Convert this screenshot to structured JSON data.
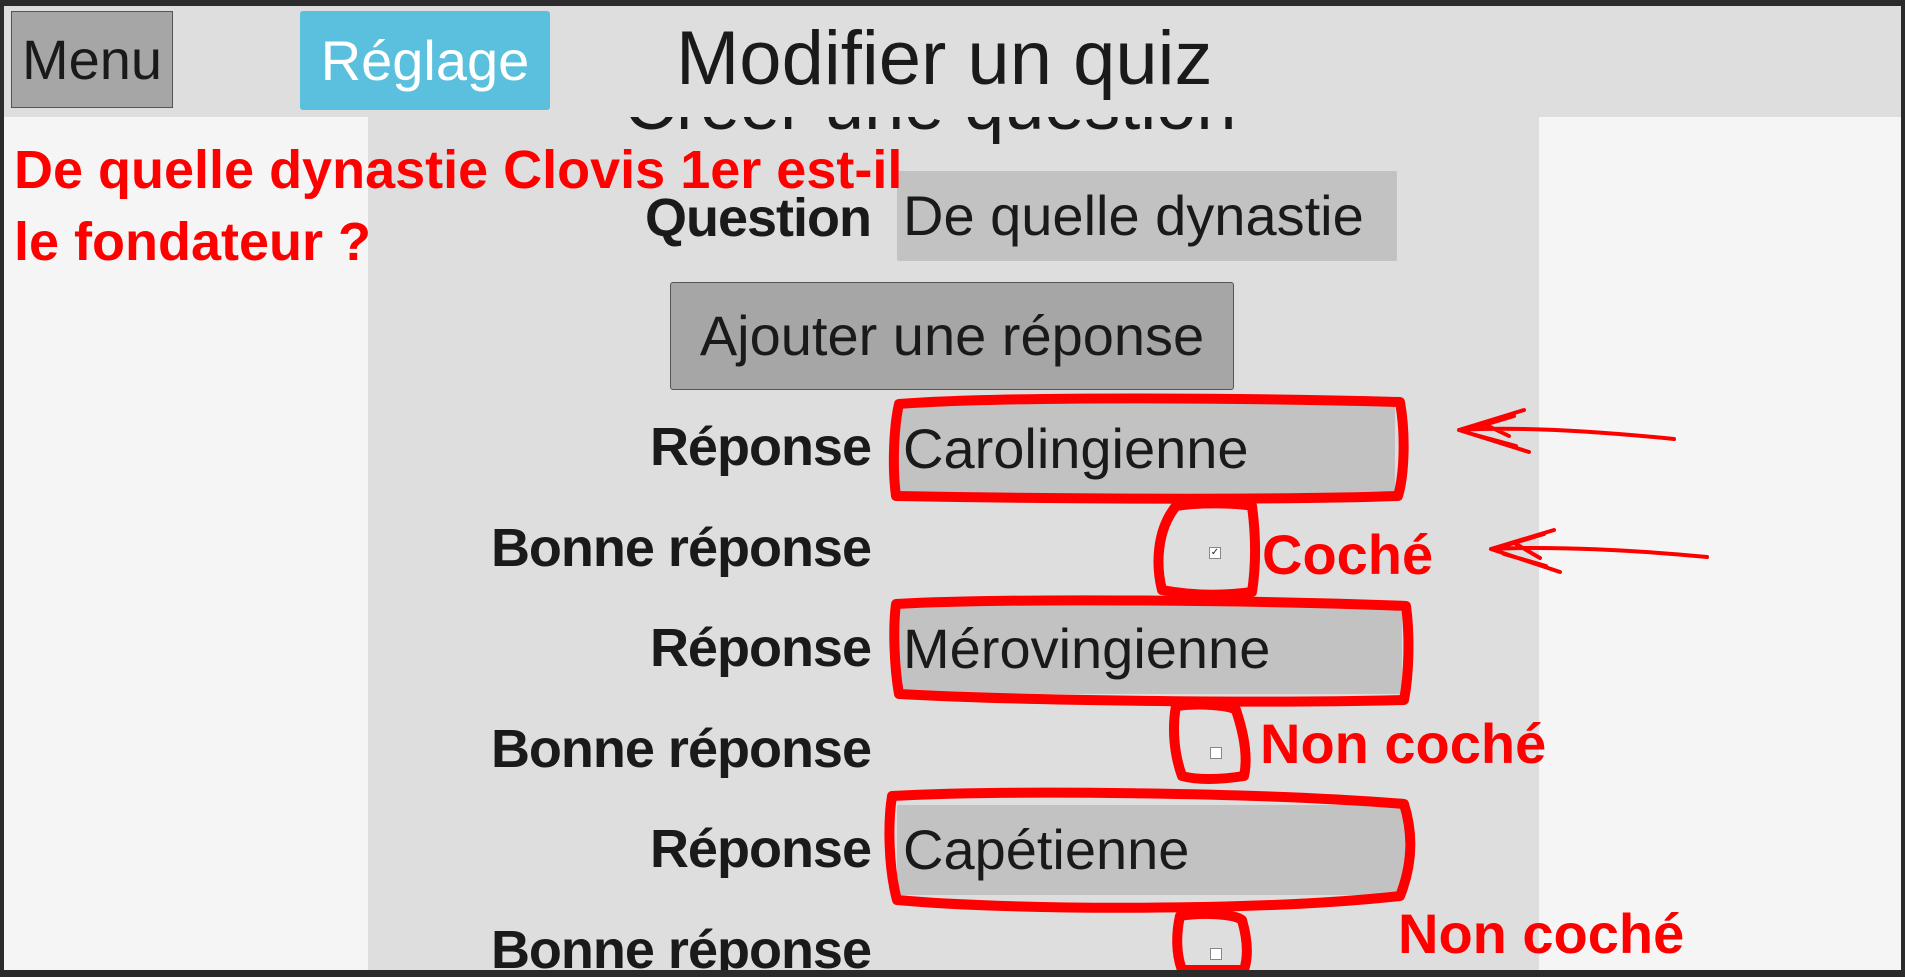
{
  "topbar": {
    "menu_label": "Menu",
    "settings_label": "Réglage",
    "title": "Modifier un quiz"
  },
  "form": {
    "section_title": "Créer une question",
    "question_label": "Question",
    "question_value": "De quelle dynastie",
    "add_answer_label": "Ajouter une réponse",
    "answers": [
      {
        "label": "Réponse",
        "value": "Carolingienne",
        "correct_label": "Bonne réponse",
        "checked": true
      },
      {
        "label": "Réponse",
        "value": "Mérovingienne",
        "correct_label": "Bonne réponse",
        "checked": false
      },
      {
        "label": "Réponse",
        "value": "Capétienne",
        "correct_label": "Bonne réponse",
        "checked": false
      }
    ]
  },
  "annotations": {
    "question_text": "De quelle dynastie Clovis 1er est-il le fondateur ?",
    "checked_note": "Coché",
    "unchecked_note_1": "Non coché",
    "unchecked_note_2": "Non coché",
    "color": "#ff0000"
  },
  "colors": {
    "topbar_bg": "#dedede",
    "settings_button": "#5bc0de",
    "menu_button": "#a6a6a6",
    "field_bg": "#c2c2c2"
  }
}
